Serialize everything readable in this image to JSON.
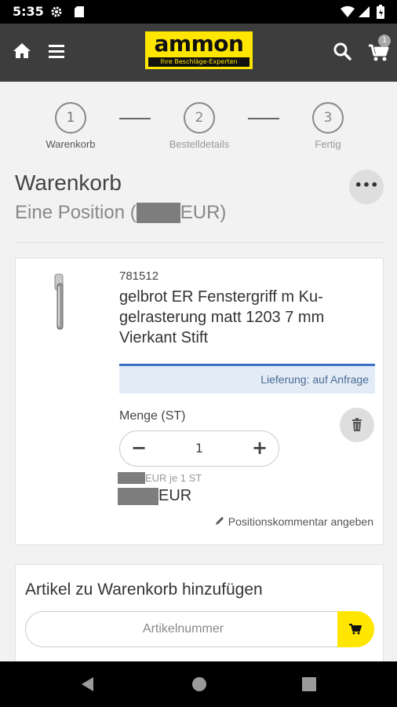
{
  "status_bar": {
    "time": "5:35",
    "icons": [
      "gear-icon",
      "sd-card-icon",
      "wifi-icon",
      "signal-icon",
      "battery-icon"
    ]
  },
  "app_bar": {
    "logo_text": "ammon",
    "logo_tagline": "Ihre Beschläge-Experten",
    "cart_count": "1",
    "colors": {
      "bar": "#3d3d3d",
      "brand": "#ffe600"
    }
  },
  "steps": [
    {
      "number": "1",
      "label": "Warenkorb"
    },
    {
      "number": "2",
      "label": "Bestelldetails"
    },
    {
      "number": "3",
      "label": "Fertig"
    }
  ],
  "header": {
    "title": "Warenkorb",
    "subtitle_prefix": "Eine Position (",
    "subtitle_suffix": "EUR)"
  },
  "item": {
    "sku": "781512",
    "name": "gelbrot ER Fenstergriff m Ku-gelrasterung matt 1203 7 mm Vierkant Stift",
    "delivery": "Lieferung: auf Anfrage",
    "quantity_label": "Menge (ST)",
    "quantity": "1",
    "unit_price_suffix": "EUR je 1 ST",
    "total_suffix": "EUR",
    "comment_link": "Positionskommentar angeben"
  },
  "add_article": {
    "title": "Artikel zu Warenkorb hinzufügen",
    "placeholder": "Artikelnummer"
  }
}
